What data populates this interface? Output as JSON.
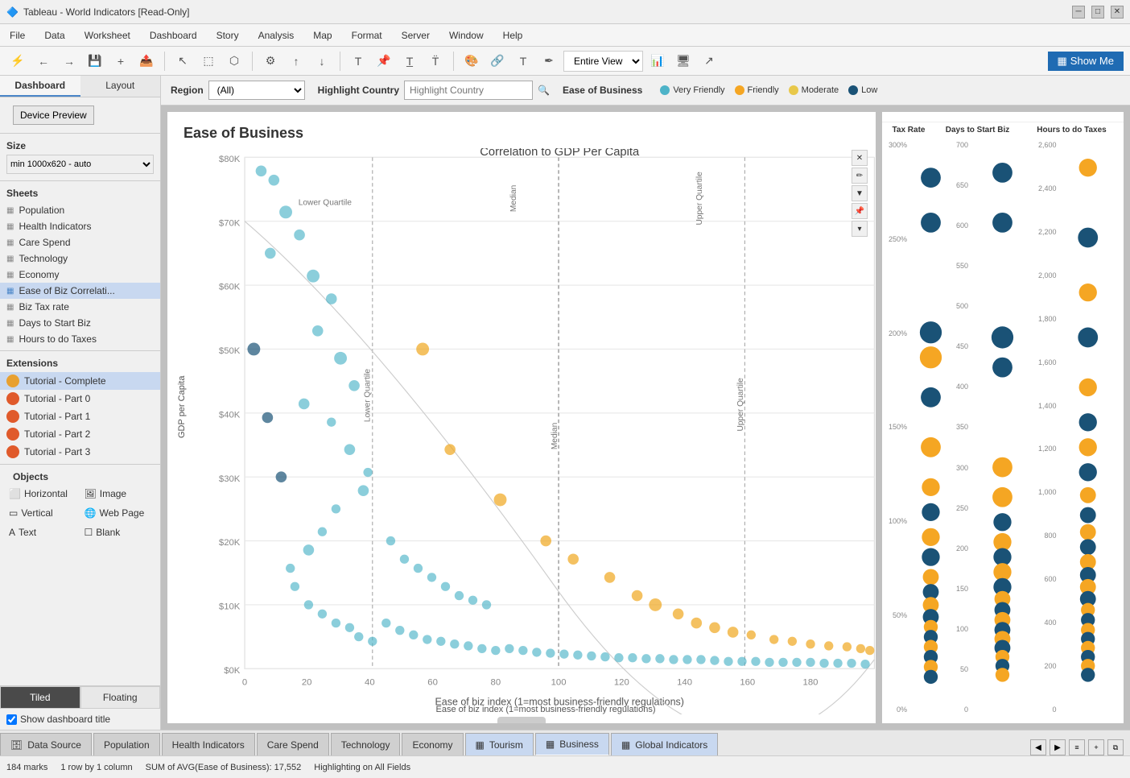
{
  "titleBar": {
    "title": "Tableau - World Indicators [Read-Only]",
    "controls": [
      "minimize",
      "maximize",
      "close"
    ]
  },
  "menuBar": {
    "items": [
      "File",
      "Data",
      "Worksheet",
      "Dashboard",
      "Story",
      "Analysis",
      "Map",
      "Format",
      "Server",
      "Window",
      "Help"
    ]
  },
  "toolbar": {
    "viewDropdown": "Entire View",
    "showMeLabel": "Show Me"
  },
  "dashboardControls": {
    "regionLabel": "Region",
    "regionValue": "(All)",
    "highlightCountryLabel": "Highlight Country",
    "highlightCountryPlaceholder": "Highlight Country",
    "easeOfBusinessLabel": "Ease of Business",
    "legend": [
      {
        "label": "Very Friendly",
        "color": "#4db3c8"
      },
      {
        "label": "Friendly",
        "color": "#f5a623"
      },
      {
        "label": "Moderate",
        "color": "#e8c84a"
      },
      {
        "label": "Low",
        "color": "#1a5276"
      }
    ]
  },
  "sidebar": {
    "tabs": [
      "Dashboard",
      "Layout"
    ],
    "activeTab": "Dashboard",
    "devicePreviewLabel": "Device Preview",
    "sizeSection": {
      "label": "Size",
      "value": "min 1000x620 - auto"
    },
    "sheetsSection": {
      "label": "Sheets",
      "items": [
        {
          "label": "Population",
          "type": "sheet"
        },
        {
          "label": "Health Indicators",
          "type": "sheet"
        },
        {
          "label": "Care Spend",
          "type": "sheet"
        },
        {
          "label": "Technology",
          "type": "sheet"
        },
        {
          "label": "Economy",
          "type": "sheet"
        },
        {
          "label": "Ease of Biz Correlati...",
          "type": "sheet",
          "active": true
        },
        {
          "label": "Biz Tax rate",
          "type": "sheet"
        },
        {
          "label": "Days to Start Biz",
          "type": "sheet"
        },
        {
          "label": "Hours to do Taxes",
          "type": "sheet"
        }
      ]
    },
    "extensionsSection": {
      "label": "Extensions",
      "items": [
        {
          "label": "Tutorial - Complete",
          "active": true
        },
        {
          "label": "Tutorial - Part 0"
        },
        {
          "label": "Tutorial - Part 1"
        },
        {
          "label": "Tutorial - Part 2"
        },
        {
          "label": "Tutorial - Part 3"
        }
      ]
    },
    "objectsSection": {
      "label": "Objects",
      "items": [
        {
          "label": "Horizontal",
          "icon": "grid"
        },
        {
          "label": "Image",
          "icon": "image"
        },
        {
          "label": "Vertical",
          "icon": "grid"
        },
        {
          "label": "Web Page",
          "icon": "globe"
        },
        {
          "label": "Text",
          "icon": "text"
        },
        {
          "label": "Blank",
          "icon": "blank"
        }
      ]
    },
    "layoutBtns": [
      "Tiled",
      "Floating"
    ],
    "activeLayout": "Tiled",
    "showDashboardTitle": true,
    "showDashboardTitleLabel": "Show dashboard title"
  },
  "mainChart": {
    "title": "Ease of Business",
    "subtitle": "Correlation to GDP Per Capita",
    "xAxisLabel": "Ease of biz index (1=most business-friendly regulations)",
    "yAxisLabel": "GDP per Capita",
    "yAxisTicks": [
      "$80K",
      "$70K",
      "$60K",
      "$50K",
      "$40K",
      "$30K",
      "$20K",
      "$10K",
      "$0K"
    ],
    "xAxisTicks": [
      "0",
      "20",
      "40",
      "60",
      "80",
      "100",
      "120",
      "140",
      "160",
      "180"
    ],
    "quarterLines": {
      "lowerQuartile": "Lower Quartile",
      "median": "Median",
      "upperQuartile": "Upper Quartile"
    },
    "taxRateYTicks": [
      "300%",
      "250%",
      "200%",
      "150%",
      "100%",
      "50%",
      "0%"
    ]
  },
  "rightPanel": {
    "columns": [
      {
        "label": "Tax Rate"
      },
      {
        "label": "Days to Start Biz"
      },
      {
        "label": "Hours to do Taxes"
      }
    ],
    "yTicks": [
      "700",
      "650",
      "600",
      "550",
      "500",
      "450",
      "400",
      "350",
      "300",
      "250",
      "200",
      "150",
      "100",
      "50",
      "0"
    ],
    "daysTicks": [
      "2,600",
      "2,400",
      "2,200",
      "2,000",
      "1,800",
      "1,600",
      "1,400",
      "1,200",
      "1,000",
      "800",
      "600",
      "400",
      "200",
      "0"
    ]
  },
  "bottomTabs": [
    {
      "label": "Data Source",
      "type": "datasource",
      "icon": "db"
    },
    {
      "label": "Population",
      "type": "sheet"
    },
    {
      "label": "Health Indicators",
      "type": "sheet"
    },
    {
      "label": "Care Spend",
      "type": "sheet"
    },
    {
      "label": "Technology",
      "type": "sheet"
    },
    {
      "label": "Economy",
      "type": "sheet"
    },
    {
      "label": "Tourism",
      "type": "dashboard",
      "icon": "grid"
    },
    {
      "label": "Business",
      "type": "dashboard",
      "icon": "grid",
      "active": true
    },
    {
      "label": "Global Indicators",
      "type": "dashboard",
      "icon": "grid"
    }
  ],
  "statusBar": {
    "marks": "184 marks",
    "rowsColumns": "1 row by 1 column",
    "sumInfo": "SUM of AVG(Ease of Business): 17,552",
    "highlightInfo": "Highlighting on All Fields"
  }
}
